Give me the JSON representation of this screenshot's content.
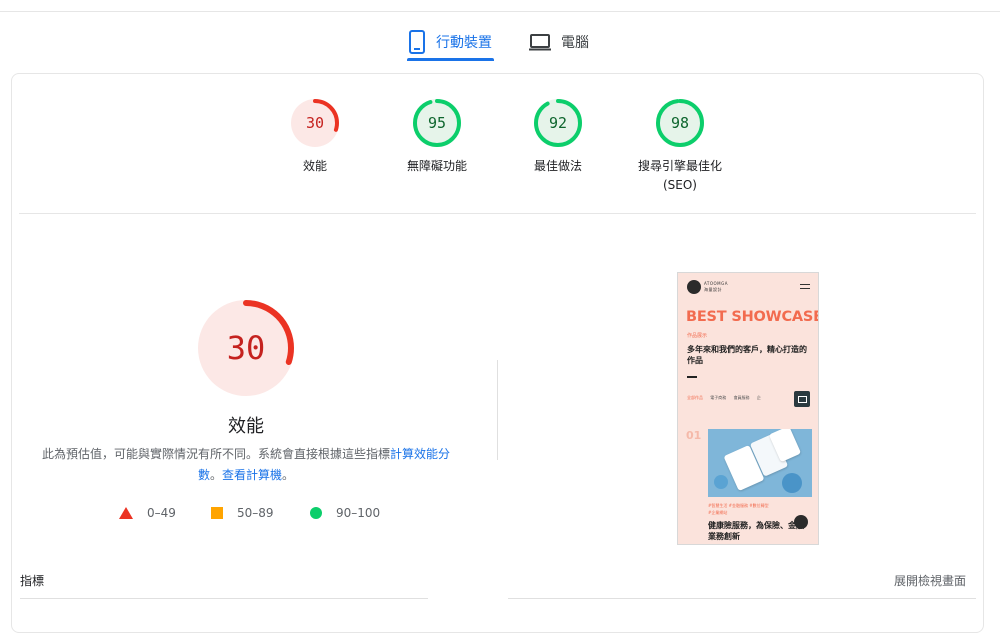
{
  "tabs": [
    {
      "label": "行動裝置",
      "active": true,
      "icon": "mobile-phone-icon"
    },
    {
      "label": "電腦",
      "active": false,
      "icon": "laptop-icon"
    }
  ],
  "scores": [
    {
      "name": "performance",
      "value": "30",
      "label": "效能",
      "label2": "",
      "fraction": 0.3,
      "color": "#c5221f",
      "stroke": "#eb3323",
      "bg": "#fce8e6"
    },
    {
      "name": "accessibility",
      "value": "95",
      "label": "無障礙功能",
      "label2": "",
      "fraction": 0.95,
      "color": "#0d652d",
      "stroke": "#0cce6b",
      "bg": "#e6f4ea"
    },
    {
      "name": "best-practices",
      "value": "92",
      "label": "最佳做法",
      "label2": "",
      "fraction": 0.92,
      "color": "#0d652d",
      "stroke": "#0cce6b",
      "bg": "#e6f4ea"
    },
    {
      "name": "seo",
      "value": "98",
      "label": "搜尋引擎最佳化",
      "label2": "(SEO)",
      "fraction": 0.98,
      "color": "#0d652d",
      "stroke": "#0cce6b",
      "bg": "#e6f4ea"
    }
  ],
  "main": {
    "score": "30",
    "fraction": 0.3,
    "title": "效能",
    "desc_text": "此為預估值，可能與實際情況有所不同。系統會直接根據這些指標",
    "link_calc": "計算效能分數",
    "desc_mid": "。",
    "link_calculator": "查看計算機",
    "desc_end": "。"
  },
  "legend": [
    {
      "range": "0–49",
      "shape": "triangle",
      "color": "#eb3323"
    },
    {
      "range": "50–89",
      "shape": "square",
      "color": "#ffa400"
    },
    {
      "range": "90–100",
      "shape": "circle",
      "color": "#0cce6b"
    }
  ],
  "footer": {
    "metrics_label": "指標",
    "expand_label": "展開檢視畫面"
  },
  "screenshot": {
    "brand_line1": "ATOOMGA",
    "brand_line2": "海量設計",
    "headline": "BEST SHOWCASE",
    "tag": "作品展示",
    "subtitle": "多年來和我們的客戶，精心打造的作品",
    "filters": [
      "全部作品",
      "電子商務",
      "會員服務",
      "企"
    ],
    "number": "01",
    "tags_line1": "#智慧生活 #金融服務 #數位轉型",
    "tags_line2": "#企業網站",
    "bottom_text": "健康險服務，為保險、金融業務創新"
  }
}
